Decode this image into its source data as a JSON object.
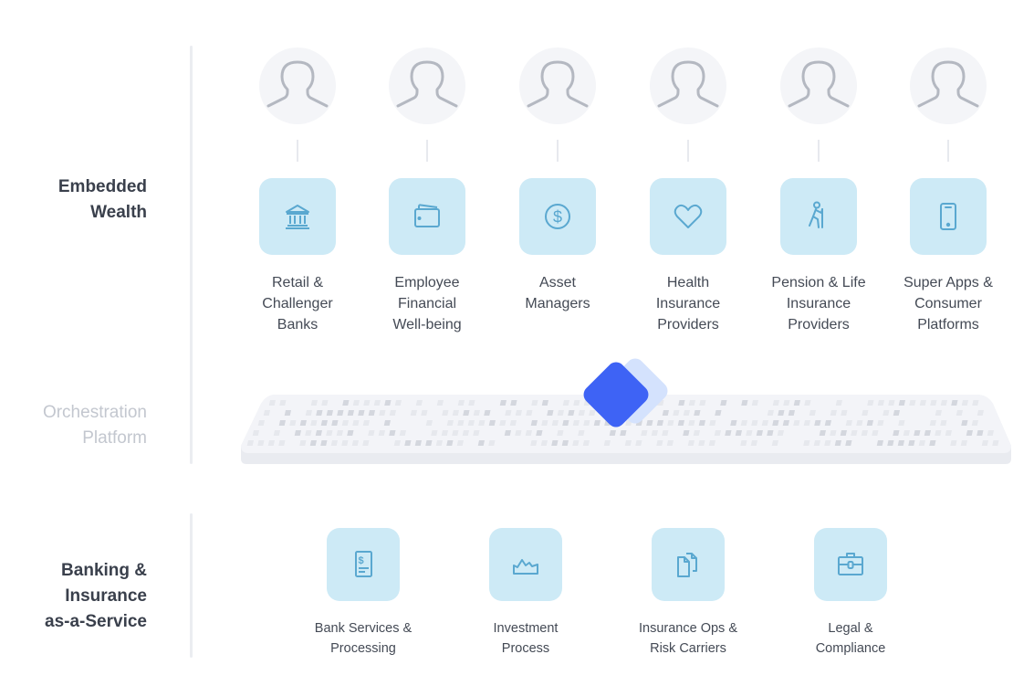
{
  "sections": {
    "embedded_wealth": "Embedded\nWealth",
    "orchestration": "Orchestration\nPlatform",
    "baas": "Banking &\nInsurance\nas-a-Service"
  },
  "colors": {
    "tile_bg": "#cdeaf6",
    "icon_stroke": "#5aa8d0",
    "avatar_bg": "#f4f5f8",
    "avatar_stroke": "#b4b8c1",
    "accent_primary": "#3e63f5",
    "accent_secondary": "#d4e2fd",
    "platform_bg": "#f3f4f8",
    "label_dark": "#3a404c",
    "label_muted": "#c3c7cf"
  },
  "embedded_wealth_items": [
    {
      "icon": "bank-icon",
      "label": "Retail &\nChallenger\nBanks"
    },
    {
      "icon": "wallet-icon",
      "label": "Employee\nFinancial\nWell-being"
    },
    {
      "icon": "dollar-coin-icon",
      "label": "Asset\nManagers"
    },
    {
      "icon": "heart-icon",
      "label": "Health\nInsurance\nProviders"
    },
    {
      "icon": "elderly-walking-icon",
      "label": "Pension & Life\nInsurance\nProviders"
    },
    {
      "icon": "smartphone-icon",
      "label": "Super Apps &\nConsumer\nPlatforms"
    }
  ],
  "baas_items": [
    {
      "icon": "invoice-icon",
      "label": "Bank Services &\nProcessing"
    },
    {
      "icon": "market-chart-icon",
      "label": "Investment\nProcess"
    },
    {
      "icon": "documents-icon",
      "label": "Insurance Ops &\nRisk Carriers"
    },
    {
      "icon": "briefcase-icon",
      "label": "Legal &\nCompliance"
    }
  ]
}
